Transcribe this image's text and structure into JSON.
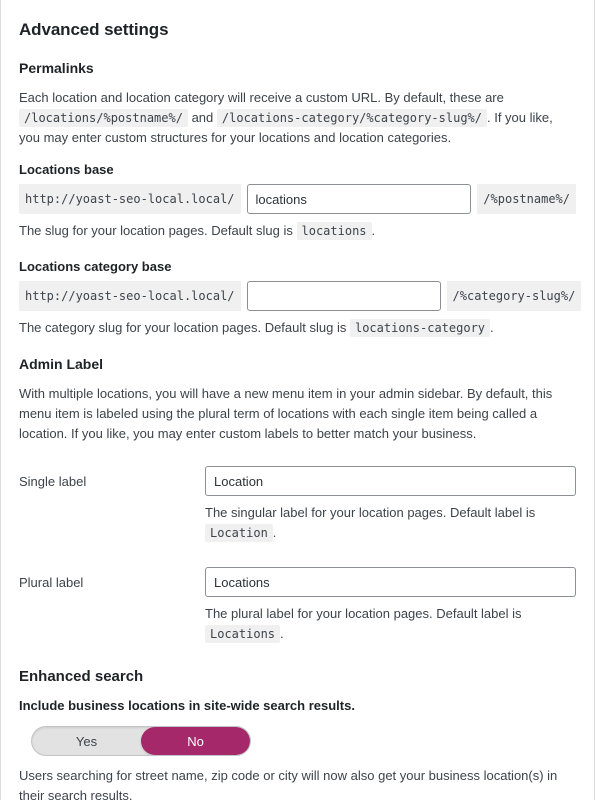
{
  "page": {
    "title": "Advanced settings"
  },
  "permalinks": {
    "heading": "Permalinks",
    "intro_part1": "Each location and location category will receive a custom URL. By default, these are",
    "intro_code1": "/locations/%postname%/",
    "intro_and": "and",
    "intro_code2": "/locations-category/%category-slug%/",
    "intro_part2": ". If you like, you may enter custom structures for your locations and location categories.",
    "locations_base": {
      "label": "Locations base",
      "prefix": "http://yoast-seo-local.local/",
      "value": "locations",
      "placeholder": "",
      "suffix": "/%postname%/",
      "desc_part1": "The slug for your location pages. Default slug is",
      "desc_code": "locations",
      "desc_part2": "."
    },
    "category_base": {
      "label": "Locations category base",
      "prefix": "http://yoast-seo-local.local/",
      "value": "",
      "placeholder": "",
      "suffix": "/%category-slug%/",
      "desc_part1": "The category slug for your location pages. Default slug is",
      "desc_code": "locations-category",
      "desc_part2": "."
    }
  },
  "admin_label": {
    "heading": "Admin Label",
    "intro": "With multiple locations, you will have a new menu item in your admin sidebar. By default, this menu item is labeled using the plural term of locations with each single item being called a location. If you like, you may enter custom labels to better match your business.",
    "single": {
      "label": "Single label",
      "value": "Location",
      "placeholder": "",
      "desc_part1": "The singular label for your location pages. Default label is",
      "desc_code": "Location",
      "desc_part2": "."
    },
    "plural": {
      "label": "Plural label",
      "value": "Locations",
      "placeholder": "",
      "desc_part1": "The plural label for your location pages. Default label is",
      "desc_code": "Locations",
      "desc_part2": "."
    }
  },
  "enhanced_search": {
    "heading": "Enhanced search",
    "question": "Include business locations in site-wide search results.",
    "toggle": {
      "yes_label": "Yes",
      "no_label": "No",
      "selected": "No",
      "active_color": "#a4286a",
      "track_color": "#e2e2e2"
    },
    "desc": "Users searching for street name, zip code or city will now also get your business location(s) in their search results."
  }
}
